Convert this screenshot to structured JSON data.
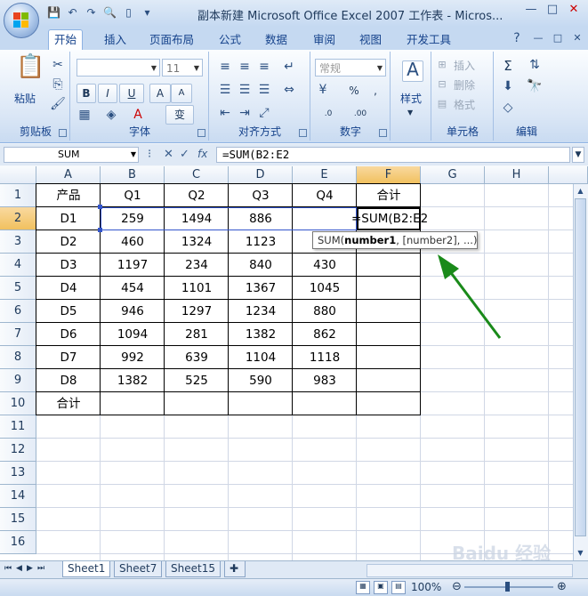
{
  "window": {
    "title": "副本新建 Microsoft Office Excel 2007 工作表 - Micros...",
    "controls": [
      "—",
      "□",
      "✕"
    ]
  },
  "ribbon_tabs": [
    "开始",
    "插入",
    "页面布局",
    "公式",
    "数据",
    "审阅",
    "视图",
    "开发工具"
  ],
  "ribbon": {
    "clipboard": {
      "paste": "粘贴",
      "label": "剪贴板"
    },
    "font": {
      "size": "11",
      "label": "字体",
      "bold": "B",
      "italic": "I",
      "underline": "U",
      "grow": "A",
      "shrink": "A",
      "phonetic": "变"
    },
    "alignment": {
      "label": "对齐方式"
    },
    "number": {
      "format": "常规",
      "label": "数字",
      "percent": "%",
      "comma": ",",
      "inc": ".0",
      "dec": ".00"
    },
    "styles": {
      "label": "样式"
    },
    "cells": {
      "insert": "插入",
      "delete": "删除",
      "format": "格式",
      "label": "单元格"
    },
    "editing": {
      "sum": "Σ",
      "label": "编辑"
    }
  },
  "formula_bar": {
    "name_box": "SUM",
    "fx": "fx",
    "formula": "=SUM(B2:E2"
  },
  "columns": [
    "A",
    "B",
    "C",
    "D",
    "E",
    "F",
    "G",
    "H"
  ],
  "rows": [
    "1",
    "2",
    "3",
    "4",
    "5",
    "6",
    "7",
    "8",
    "9",
    "10",
    "11",
    "12",
    "13",
    "14",
    "15",
    "16"
  ],
  "table": {
    "header": [
      "产品",
      "Q1",
      "Q2",
      "Q3",
      "Q4",
      "合计"
    ],
    "data": [
      [
        "D1",
        "259",
        "1494",
        "886",
        "",
        ""
      ],
      [
        "D2",
        "460",
        "1324",
        "1123",
        "",
        ""
      ],
      [
        "D3",
        "1197",
        "234",
        "840",
        "430",
        ""
      ],
      [
        "D4",
        "454",
        "1101",
        "1367",
        "1045",
        ""
      ],
      [
        "D5",
        "946",
        "1297",
        "1234",
        "880",
        ""
      ],
      [
        "D6",
        "1094",
        "281",
        "1382",
        "862",
        ""
      ],
      [
        "D7",
        "992",
        "639",
        "1104",
        "1118",
        ""
      ],
      [
        "D8",
        "1382",
        "525",
        "590",
        "983",
        ""
      ]
    ],
    "total_row": [
      "合计",
      "",
      "",
      "",
      "",
      ""
    ]
  },
  "editing_cell": {
    "text": "=SUM(B2:E2"
  },
  "tooltip": {
    "func": "SUM(",
    "arg1": "number1",
    "rest": ", [number2], ...)"
  },
  "sheets": [
    "Sheet1",
    "Sheet7",
    "Sheet15"
  ],
  "status": {
    "zoom": "100%"
  },
  "watermark": "Baidu 经验",
  "colors": {
    "arrow": "#1a8a1a",
    "selected_header": "#f1c15f",
    "ref_highlight": "#3355cc"
  }
}
